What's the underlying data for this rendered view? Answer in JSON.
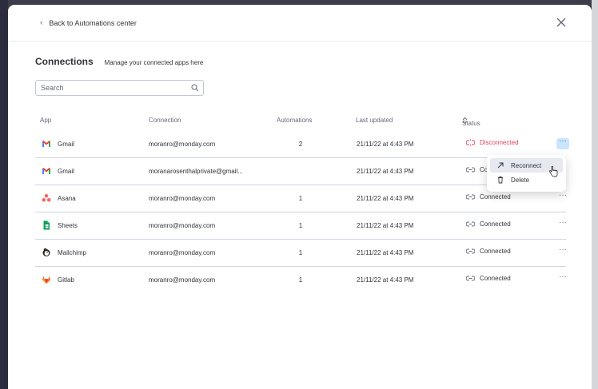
{
  "header": {
    "back_label": "Back to Automations center"
  },
  "page": {
    "title": "Connections",
    "subtitle": "Manage your connected apps here"
  },
  "search": {
    "placeholder": "Search"
  },
  "table": {
    "columns": {
      "app": "App",
      "connection": "Connection",
      "automations": "Automations",
      "last_updated": "Last updated",
      "status": "Status"
    },
    "rows": [
      {
        "app": "Gmail",
        "app_icon": "gmail-icon",
        "connection": "moranro@monday.com",
        "automations": "2",
        "last_updated": "21/11/22 at 4:43 PM",
        "status": "Disconnected"
      },
      {
        "app": "Gmail",
        "app_icon": "gmail-icon",
        "connection": "moranarosenthalprivate@gmail...",
        "automations": "",
        "last_updated": "21/11/22 at 4:43 PM",
        "status": "Co"
      },
      {
        "app": "Asana",
        "app_icon": "asana-icon",
        "connection": "moranro@monday.com",
        "automations": "1",
        "last_updated": "21/11/22 at 4:43 PM",
        "status": "Connected"
      },
      {
        "app": "Sheets",
        "app_icon": "sheets-icon",
        "connection": "moranro@monday.com",
        "automations": "1",
        "last_updated": "21/11/22 at 4:43 PM",
        "status": "Connected"
      },
      {
        "app": "Mailchimp",
        "app_icon": "mailchimp-icon",
        "connection": "moranro@monday.com",
        "automations": "1",
        "last_updated": "21/11/22 at 4:43 PM",
        "status": "Connected"
      },
      {
        "app": "Gitlab",
        "app_icon": "gitlab-icon",
        "connection": "moranro@monday.com",
        "automations": "1",
        "last_updated": "21/11/22 at 4:43 PM",
        "status": "Connected"
      }
    ]
  },
  "context_menu": {
    "reconnect": "Reconnect",
    "delete": "Delete"
  },
  "colors": {
    "disconnected": "#e2445c",
    "accent": "#0073ea"
  }
}
